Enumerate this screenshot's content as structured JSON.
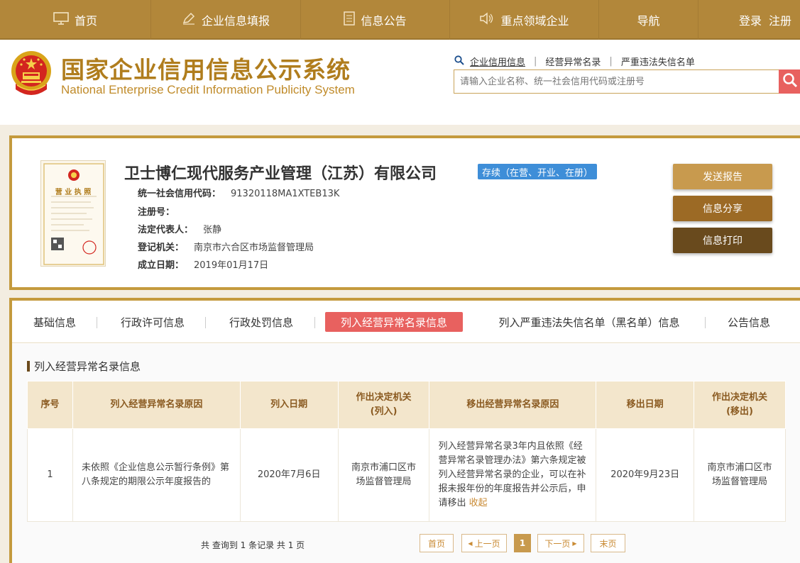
{
  "nav": {
    "items": [
      {
        "label": "首页",
        "icon": "monitor-icon"
      },
      {
        "label": "企业信息填报",
        "icon": "pen-icon"
      },
      {
        "label": "信息公告",
        "icon": "document-icon"
      },
      {
        "label": "重点领域企业",
        "icon": "speaker-icon"
      },
      {
        "label": "导航",
        "icon": ""
      }
    ],
    "login": "登录",
    "register": "注册"
  },
  "header": {
    "title": "国家企业信用信息公示系统",
    "subtitle": "National Enterprise Credit Information Publicity System",
    "search_links": [
      "企业信用信息",
      "经营异常名录",
      "严重违法失信名单"
    ],
    "search_placeholder": "请输入企业名称、统一社会信用代码或注册号"
  },
  "company": {
    "name": "卫士博仁现代服务产业管理（江苏）有限公司",
    "status": "存续（在营、开业、在册）",
    "fields": [
      {
        "label": "统一社会信用代码：",
        "value": "91320118MA1XTEB13K"
      },
      {
        "label": "注册号：",
        "value": ""
      },
      {
        "label": "法定代表人：",
        "value": "张静"
      },
      {
        "label": "登记机关：",
        "value": "南京市六合区市场监督管理局"
      },
      {
        "label": "成立日期：",
        "value": "2019年01月17日"
      }
    ],
    "license_title": "营 业 执 照",
    "buttons": {
      "send": "发送报告",
      "share": "信息分享",
      "print": "信息打印"
    }
  },
  "tabs": [
    "基础信息",
    "行政许可信息",
    "行政处罚信息",
    "列入经营异常名录信息",
    "列入严重违法失信名单（黑名单）信息",
    "公告信息"
  ],
  "active_tab_index": 3,
  "section_title": "列入经营异常名录信息",
  "table": {
    "headers": [
      [
        "序号"
      ],
      [
        "列入经营异常名录原因"
      ],
      [
        "列入日期"
      ],
      [
        "作出决定机关",
        "(列入)"
      ],
      [
        "移出经营异常名录原因"
      ],
      [
        "移出日期"
      ],
      [
        "作出决定机关",
        "(移出)"
      ]
    ],
    "rows": [
      {
        "index": "1",
        "reason_in": "未依照《企业信息公示暂行条例》第八条规定的期限公示年度报告的",
        "date_in": "2020年7月6日",
        "org_in": "南京市浦口区市场监督管理局",
        "reason_out": "列入经营异常名录3年内且依照《经营异常名录管理办法》第六条规定被列入经营异常名录的企业，可以在补报未报年份的年度报告并公示后，申请移出",
        "reason_out_link": "收起",
        "date_out": "2020年9月23日",
        "org_out": "南京市浦口区市场监督管理局"
      }
    ]
  },
  "pager": {
    "info": "共 查询到 1 条记录 共 1 页",
    "first": "首页",
    "prev": "上一页",
    "current": "1",
    "next": "下一页",
    "last": "末页"
  },
  "colors": {
    "nav_bg": "#b2873a",
    "title_gold": "#b07d1d",
    "active_tab": "#e8615f",
    "status_blue": "#3e8ed8"
  }
}
